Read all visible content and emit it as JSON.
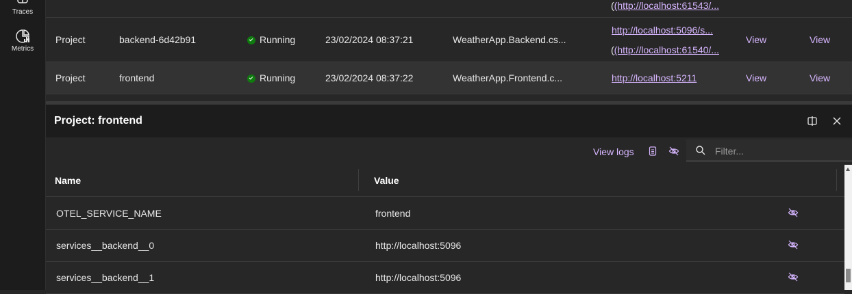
{
  "nav": {
    "traces_label": "Traces",
    "metrics_label": "Metrics"
  },
  "resources": {
    "rows": [
      {
        "url2": "(http://localhost:61543/..."
      },
      {
        "type": "Project",
        "name": "backend-6d42b91",
        "state": "Running",
        "start_time": "23/02/2024 08:37:21",
        "source": "WeatherApp.Backend.cs...",
        "url1": "http://localhost:5096/s...",
        "url2": "(http://localhost:61540/...",
        "env": "View",
        "logs": "View"
      },
      {
        "type": "Project",
        "name": "frontend",
        "state": "Running",
        "start_time": "23/02/2024 08:37:22",
        "source": "WeatherApp.Frontend.c...",
        "url1": "http://localhost:5211",
        "env": "View",
        "logs": "View"
      }
    ]
  },
  "details": {
    "title": "Project: frontend",
    "view_logs": "View logs",
    "filter_placeholder": "Filter...",
    "columns": {
      "name": "Name",
      "value": "Value"
    },
    "env": [
      {
        "name": "OTEL_SERVICE_NAME",
        "value": "frontend"
      },
      {
        "name": "services__backend__0",
        "value": "http://localhost:5096"
      },
      {
        "name": "services__backend__1",
        "value": "http://localhost:5096"
      }
    ]
  },
  "colors": {
    "accent": "#d7b6ff",
    "running": "#0f7b0f",
    "background": "#272727",
    "sidebar": "#1c1c1c"
  },
  "icons": [
    "traces-icon",
    "metrics-icon",
    "split-view-icon",
    "close-icon",
    "copy-icon",
    "eye-off-icon",
    "search-icon"
  ]
}
